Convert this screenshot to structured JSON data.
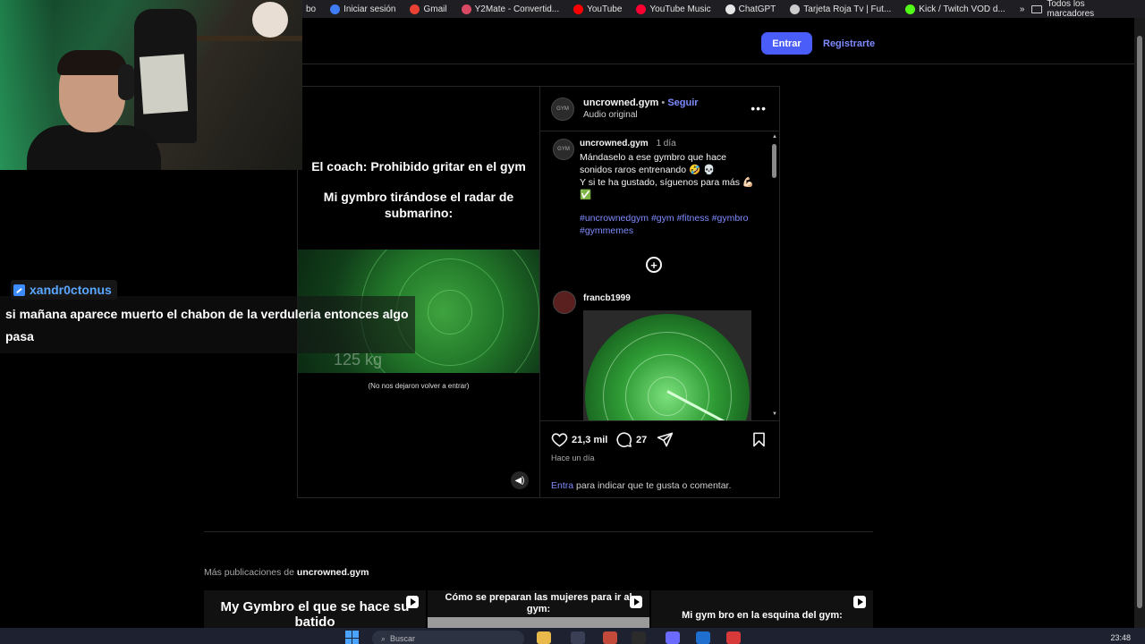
{
  "bookmarks": {
    "items": [
      {
        "label": "bo",
        "color": "#888888"
      },
      {
        "label": "Iniciar sesión",
        "color": "#3f7cf5"
      },
      {
        "label": "Gmail",
        "color": "#e94235"
      },
      {
        "label": "Y2Mate - Convertid...",
        "color": "#d84a64"
      },
      {
        "label": "YouTube",
        "color": "#ff0000"
      },
      {
        "label": "YouTube Music",
        "color": "#ff0033"
      },
      {
        "label": "ChatGPT",
        "color": "#e6e6e6"
      },
      {
        "label": "Tarjeta Roja Tv | Fut...",
        "color": "#cccccc"
      },
      {
        "label": "Kick / Twitch VOD d...",
        "color": "#53fc18"
      }
    ],
    "overflow_label": "»",
    "all_bookmarks_label": "Todos los marcadores"
  },
  "header": {
    "login_label": "Entrar",
    "signup_label": "Registrarte"
  },
  "post": {
    "video": {
      "caption_line1": "El coach: Prohibido gritar en el gym",
      "caption_line2": "Mi gymbro tirándose el radar de submarino:",
      "overlay_weight": "125 kg",
      "subtitle": "(No nos dejaron volver a entrar)",
      "mute_icon": "volume-icon"
    },
    "author": {
      "username": "uncrowned.gym",
      "separator": "•",
      "follow_label": "Seguir",
      "audio": "Audio original",
      "avatar_text": "GYM"
    },
    "caption": {
      "username": "uncrowned.gym",
      "time": "1 día",
      "text_line1": "Mándaselo a ese gymbro que hace sonidos raros entrenando 🤣 💀",
      "text_line2": "Y si te ha gustado, síguenos para más 💪🏻 ✅",
      "hashtags": "#uncrownedgym #gym #fitness #gymbro #gymmemes"
    },
    "comment": {
      "username": "francb1999"
    },
    "stats": {
      "likes": "21,3 mil",
      "comments": "27"
    },
    "posted": "Hace un día",
    "login_prompt_link": "Entra",
    "login_prompt_text": " para indicar que te gusta o comentar."
  },
  "more_posts": {
    "prefix": "Más publicaciones de ",
    "username": "uncrowned.gym",
    "items": [
      {
        "text": "My Gymbro el que se hace su batido"
      },
      {
        "text": "Cómo se preparan las mujeres para ir al gym:"
      },
      {
        "text": "Mi gym bro en la esquina del gym:"
      }
    ]
  },
  "stream_chat": {
    "username": "xandr0ctonus",
    "message": "si mañana aparece muerto el chabon de la verduleria entonces algo pasa"
  },
  "taskbar": {
    "search_placeholder": "Buscar",
    "clock": "23:48"
  }
}
